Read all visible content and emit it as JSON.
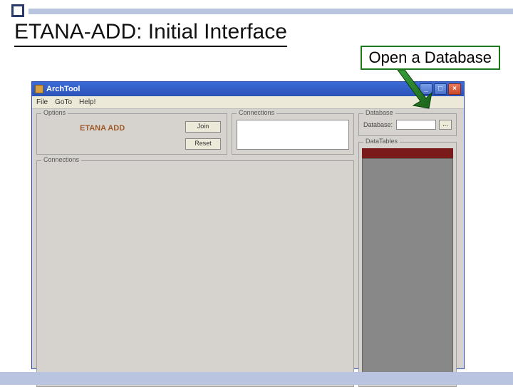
{
  "slide": {
    "title": "ETANA-ADD: Initial Interface",
    "annotation": "Open a Database"
  },
  "window": {
    "title": "ArchTool",
    "min": "_",
    "max": "□",
    "close": "×"
  },
  "menu": {
    "file": "File",
    "goto": "GoTo",
    "help": "Help!"
  },
  "groups": {
    "options": "Options",
    "connections_top": "Connections",
    "database": "Database",
    "datatables": "DataTables",
    "connections_main": "Connections"
  },
  "options_panel": {
    "logo": "ETANA ADD",
    "join": "Join",
    "reset": "Reset"
  },
  "database_panel": {
    "label": "Database:",
    "value": "",
    "browse": "..."
  }
}
